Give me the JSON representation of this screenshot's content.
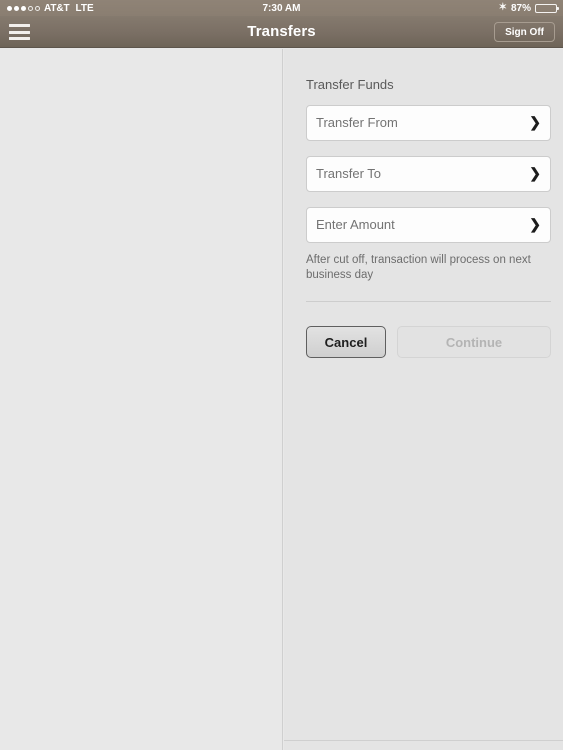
{
  "status_bar": {
    "signal_dots_filled": 3,
    "signal_dots_empty": 2,
    "carrier": "AT&T",
    "network": "LTE",
    "time": "7:30 AM",
    "bluetooth_icon": "✶",
    "battery_percent": "87%",
    "battery_level": 87
  },
  "nav_bar": {
    "menu_icon": "hamburger-menu-icon",
    "title": "Transfers",
    "sign_off_label": "Sign Off"
  },
  "transfer_panel": {
    "section_title": "Transfer Funds",
    "fields": [
      {
        "label": "Transfer From",
        "chevron": "❯"
      },
      {
        "label": "Transfer To",
        "chevron": "❯"
      },
      {
        "label": "Enter Amount",
        "chevron": "❯"
      }
    ],
    "note": "After cut off, transaction will process on next business day",
    "buttons": {
      "cancel_label": "Cancel",
      "continue_label": "Continue"
    }
  },
  "colors": {
    "nav_brown_top": "#857a6e",
    "nav_brown_bottom": "#6e6458",
    "status_brown": "#8a7e71",
    "panel_background": "#e4e4e4",
    "left_pane_background": "#e8e8e8",
    "field_background": "#fdfdfd",
    "field_border": "#cccccc",
    "text_muted": "#737373",
    "continue_disabled_text": "#b4b4b4"
  }
}
